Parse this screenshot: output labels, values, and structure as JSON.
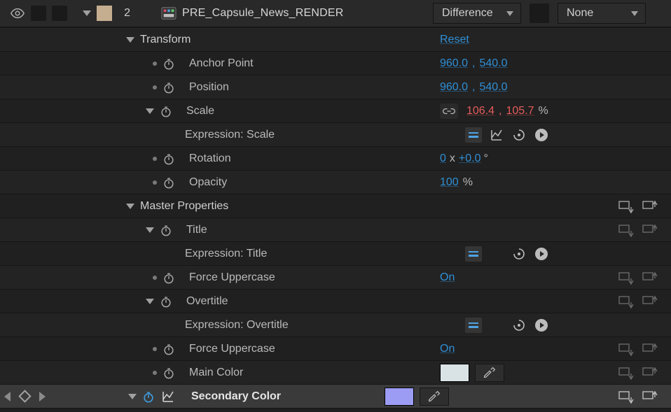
{
  "layer": {
    "index": "2",
    "name": "PRE_Capsule_News_RENDER",
    "blend_mode": "Difference",
    "track_matte": "None"
  },
  "transform": {
    "label": "Transform",
    "reset": "Reset",
    "anchor_point": {
      "label": "Anchor Point",
      "x": "960.0",
      "y": "540.0"
    },
    "position": {
      "label": "Position",
      "x": "960.0",
      "y": "540.0"
    },
    "scale": {
      "label": "Scale",
      "x": "106.4",
      "y": "105.7",
      "pct": "%",
      "expr_label": "Expression: Scale"
    },
    "rotation": {
      "label": "Rotation",
      "turns": "0",
      "x_sep": "x",
      "deg": "+0.0",
      "deg_sym": "°"
    },
    "opacity": {
      "label": "Opacity",
      "value": "100",
      "pct": "%"
    }
  },
  "master": {
    "label": "Master Properties",
    "title": {
      "label": "Title",
      "expr_label": "Expression: Title"
    },
    "force_upper1": {
      "label": "Force Uppercase",
      "value": "On"
    },
    "overtitle": {
      "label": "Overtitle",
      "expr_label": "Expression: Overtitle"
    },
    "force_upper2": {
      "label": "Force Uppercase",
      "value": "On"
    },
    "main_color": {
      "label": "Main Color",
      "hex": "#d9e3e6"
    },
    "secondary_color": {
      "label": "Secondary Color",
      "hex": "#9c9cf5"
    }
  }
}
